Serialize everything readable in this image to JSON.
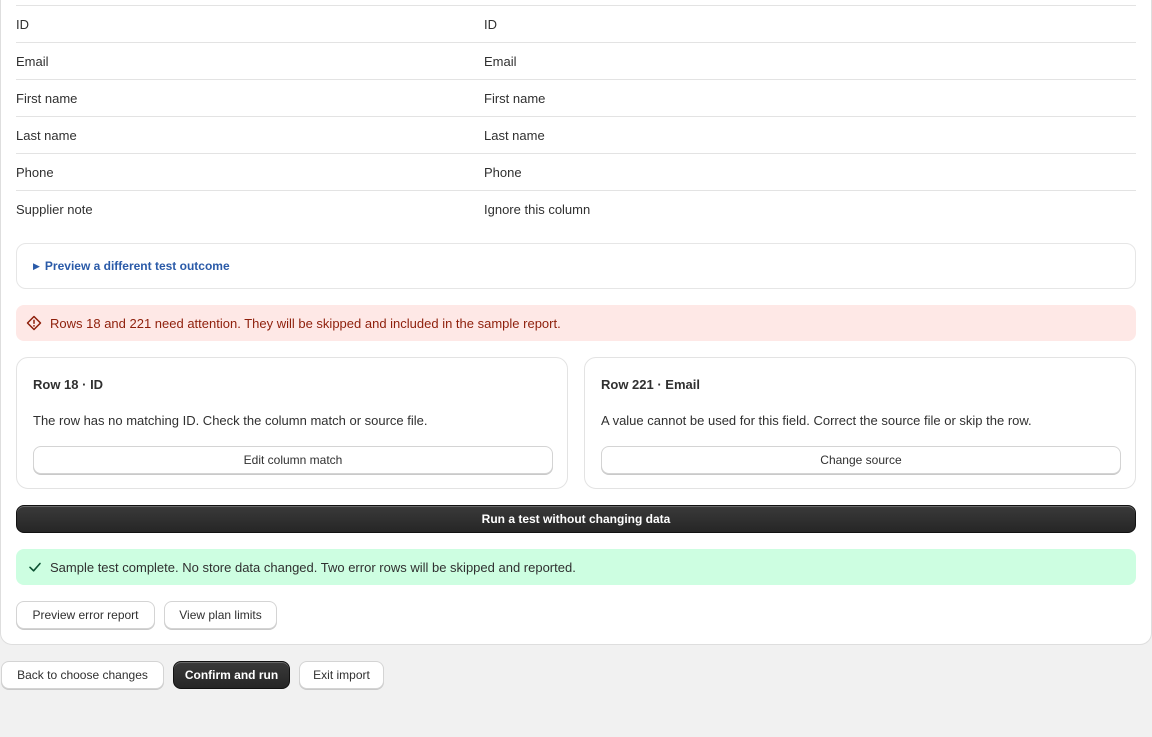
{
  "mapping": {
    "rows": [
      {
        "source": "ID",
        "target": "ID"
      },
      {
        "source": "Email",
        "target": "Email"
      },
      {
        "source": "First name",
        "target": "First name"
      },
      {
        "source": "Last name",
        "target": "Last name"
      },
      {
        "source": "Phone",
        "target": "Phone"
      },
      {
        "source": "Supplier note",
        "target": "Ignore this column"
      }
    ]
  },
  "outcome_toggle": {
    "label": "Preview a different test outcome",
    "icon": "disclosure-triangle-icon"
  },
  "critical_banner": {
    "text": "Rows 18 and 221 need attention. They will be skipped and included in the sample report.",
    "icon": "alert-diamond-icon",
    "color": "#8e1f0b",
    "background": "#fee8e6"
  },
  "issues": [
    {
      "title": "Row 18 · ID",
      "description": "The row has no matching ID. Check the column match or source file.",
      "action": "Edit column match"
    },
    {
      "title": "Row 221 · Email",
      "description": "A value cannot be used for this field. Correct the source file or skip the row.",
      "action": "Change source"
    }
  ],
  "test_button": {
    "label": "Run a test without changing data"
  },
  "success_banner": {
    "text": "Sample test complete. No store data changed. Two error rows will be skipped and reported.",
    "icon": "checkmark-icon",
    "background": "#cdfee1"
  },
  "secondary_actions": {
    "preview_report": "Preview error report",
    "plan_limits": "View plan limits"
  },
  "footer": {
    "back": "Back to choose changes",
    "confirm": "Confirm and run",
    "exit": "Exit import"
  }
}
